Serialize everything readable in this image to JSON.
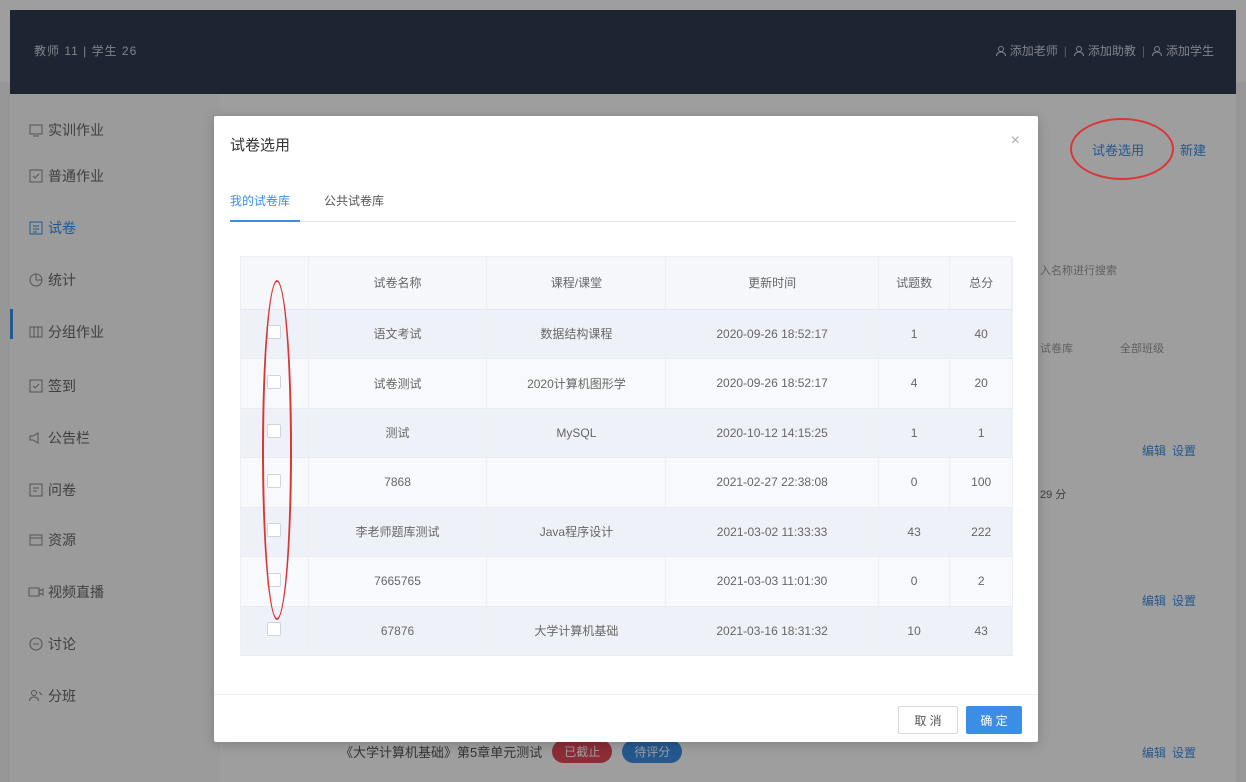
{
  "topbar": {
    "stats": "教师 11 | 学生 26",
    "add_teacher": "添加老师",
    "add_assistant": "添加助教",
    "add_student": "添加学生",
    "sep": "|"
  },
  "sidebar": {
    "items": [
      {
        "label": "实训作业",
        "icon": "training-icon"
      },
      {
        "label": "普通作业",
        "icon": "homework-icon"
      },
      {
        "label": "试卷",
        "icon": "exam-icon"
      },
      {
        "label": "统计",
        "icon": "stats-icon"
      },
      {
        "label": "分组作业",
        "icon": "group-icon"
      },
      {
        "label": "签到",
        "icon": "checkin-icon"
      },
      {
        "label": "公告栏",
        "icon": "notice-icon"
      },
      {
        "label": "问卷",
        "icon": "survey-icon"
      },
      {
        "label": "资源",
        "icon": "resource-icon"
      },
      {
        "label": "视频直播",
        "icon": "video-icon"
      },
      {
        "label": "讨论",
        "icon": "discuss-icon"
      },
      {
        "label": "分班",
        "icon": "class-icon"
      }
    ]
  },
  "background": {
    "select_paper": "试卷选用",
    "new": "新建",
    "search_placeholder": "入名称进行搜索",
    "filter_a": "试卷库",
    "filter_b": "全部班级",
    "edit": "编辑",
    "settings": "设置",
    "time_left": "29 分",
    "bottom_title": "《大学计算机基础》第5章单元测试",
    "pill_published": "已截止",
    "pill_pending": "待评分"
  },
  "modal": {
    "title": "试卷选用",
    "close": "×",
    "tabs": [
      "我的试卷库",
      "公共试卷库"
    ],
    "columns": [
      "",
      "试卷名称",
      "课程/课堂",
      "更新时间",
      "试题数",
      "总分"
    ],
    "rows": [
      {
        "name": "语文考试",
        "course": "数据结构课程",
        "updated": "2020-09-26 18:52:17",
        "count": "1",
        "score": "40"
      },
      {
        "name": "试卷测试",
        "course": "2020计算机图形学",
        "updated": "2020-09-26 18:52:17",
        "count": "4",
        "score": "20"
      },
      {
        "name": "测试",
        "course": "MySQL",
        "updated": "2020-10-12 14:15:25",
        "count": "1",
        "score": "1"
      },
      {
        "name": "7868",
        "course": "",
        "updated": "2021-02-27 22:38:08",
        "count": "0",
        "score": "100"
      },
      {
        "name": "李老师题库测试",
        "course": "Java程序设计",
        "updated": "2021-03-02 11:33:33",
        "count": "43",
        "score": "222"
      },
      {
        "name": "7665765",
        "course": "",
        "updated": "2021-03-03 11:01:30",
        "count": "0",
        "score": "2"
      },
      {
        "name": "67876",
        "course": "大学计算机基础",
        "updated": "2021-03-16 18:31:32",
        "count": "10",
        "score": "43"
      }
    ],
    "cancel": "取 消",
    "confirm": "确 定"
  },
  "colors": {
    "accent": "#3a8ee6",
    "annotation": "#d93636",
    "topbar": "#2f3a52"
  }
}
